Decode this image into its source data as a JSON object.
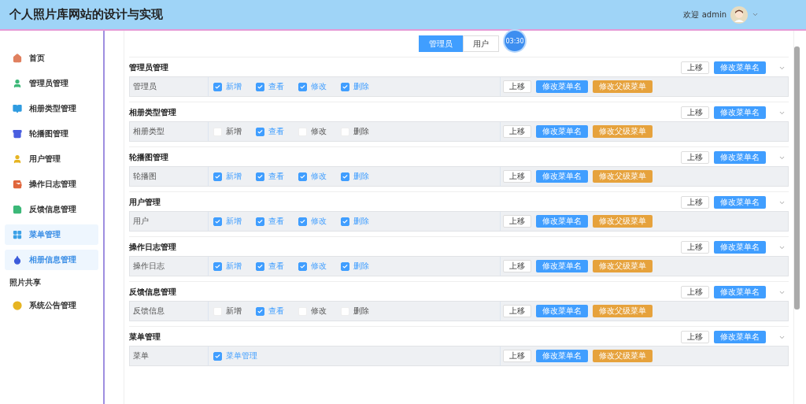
{
  "header": {
    "title": "个人照片库网站的设计与实现",
    "welcome": "欢迎 admin"
  },
  "sidebar": {
    "items": [
      {
        "kind": "link",
        "label": "首页",
        "color": "#e0805f",
        "selected": false
      },
      {
        "kind": "link",
        "label": "管理员管理",
        "color": "#3cb878",
        "selected": false
      },
      {
        "kind": "link",
        "label": "相册类型管理",
        "color": "#2f9be0",
        "selected": false
      },
      {
        "kind": "link",
        "label": "轮播图管理",
        "color": "#4a5fe0",
        "selected": false
      },
      {
        "kind": "link",
        "label": "用户管理",
        "color": "#e6b422",
        "selected": false
      },
      {
        "kind": "link",
        "label": "操作日志管理",
        "color": "#e0663c",
        "selected": false
      },
      {
        "kind": "link",
        "label": "反馈信息管理",
        "color": "#3cb878",
        "selected": false
      },
      {
        "kind": "link",
        "label": "菜单管理",
        "color": "#3aa0e6",
        "selected": true
      },
      {
        "kind": "link",
        "label": "相册信息管理",
        "color": "#3b5bdb",
        "selected": true
      },
      {
        "kind": "group",
        "label": "照片共享"
      },
      {
        "kind": "link",
        "label": "系统公告管理",
        "color": "#e6b422",
        "selected": false
      }
    ]
  },
  "tabs": [
    {
      "label": "管理员",
      "selected": true
    },
    {
      "label": "用户",
      "selected": false
    }
  ],
  "timer": "03:30",
  "sections": [
    {
      "title": "管理员管理",
      "up": "上移",
      "rename": "修改菜单名",
      "row": {
        "label": "管理员",
        "permissions": [
          {
            "label": "新增",
            "checked": true
          },
          {
            "label": "查看",
            "checked": true
          },
          {
            "label": "修改",
            "checked": true
          },
          {
            "label": "删除",
            "checked": true
          }
        ],
        "up": "上移",
        "rename": "修改菜单名",
        "parent": "修改父级菜单"
      }
    },
    {
      "title": "相册类型管理",
      "up": "上移",
      "rename": "修改菜单名",
      "row": {
        "label": "相册类型",
        "permissions": [
          {
            "label": "新增",
            "checked": false
          },
          {
            "label": "查看",
            "checked": true
          },
          {
            "label": "修改",
            "checked": false
          },
          {
            "label": "删除",
            "checked": false
          }
        ],
        "up": "上移",
        "rename": "修改菜单名",
        "parent": "修改父级菜单"
      }
    },
    {
      "title": "轮播图管理",
      "up": "上移",
      "rename": "修改菜单名",
      "row": {
        "label": "轮播图",
        "permissions": [
          {
            "label": "新增",
            "checked": true
          },
          {
            "label": "查看",
            "checked": true
          },
          {
            "label": "修改",
            "checked": true
          },
          {
            "label": "删除",
            "checked": true
          }
        ],
        "up": "上移",
        "rename": "修改菜单名",
        "parent": "修改父级菜单"
      }
    },
    {
      "title": "用户管理",
      "up": "上移",
      "rename": "修改菜单名",
      "row": {
        "label": "用户",
        "permissions": [
          {
            "label": "新增",
            "checked": true
          },
          {
            "label": "查看",
            "checked": true
          },
          {
            "label": "修改",
            "checked": true
          },
          {
            "label": "删除",
            "checked": true
          }
        ],
        "up": "上移",
        "rename": "修改菜单名",
        "parent": "修改父级菜单"
      }
    },
    {
      "title": "操作日志管理",
      "up": "上移",
      "rename": "修改菜单名",
      "row": {
        "label": "操作日志",
        "permissions": [
          {
            "label": "新增",
            "checked": true
          },
          {
            "label": "查看",
            "checked": true
          },
          {
            "label": "修改",
            "checked": true
          },
          {
            "label": "删除",
            "checked": true
          }
        ],
        "up": "上移",
        "rename": "修改菜单名",
        "parent": "修改父级菜单"
      }
    },
    {
      "title": "反馈信息管理",
      "up": "上移",
      "rename": "修改菜单名",
      "row": {
        "label": "反馈信息",
        "permissions": [
          {
            "label": "新增",
            "checked": false
          },
          {
            "label": "查看",
            "checked": true
          },
          {
            "label": "修改",
            "checked": false
          },
          {
            "label": "删除",
            "checked": false
          }
        ],
        "up": "上移",
        "rename": "修改菜单名",
        "parent": "修改父级菜单"
      }
    },
    {
      "title": "菜单管理",
      "up": "上移",
      "rename": "修改菜单名",
      "row": {
        "label": "菜单",
        "permissions": [
          {
            "label": "菜单管理",
            "checked": true
          }
        ],
        "up": "上移",
        "rename": "修改菜单名",
        "parent": "修改父级菜单"
      }
    }
  ]
}
